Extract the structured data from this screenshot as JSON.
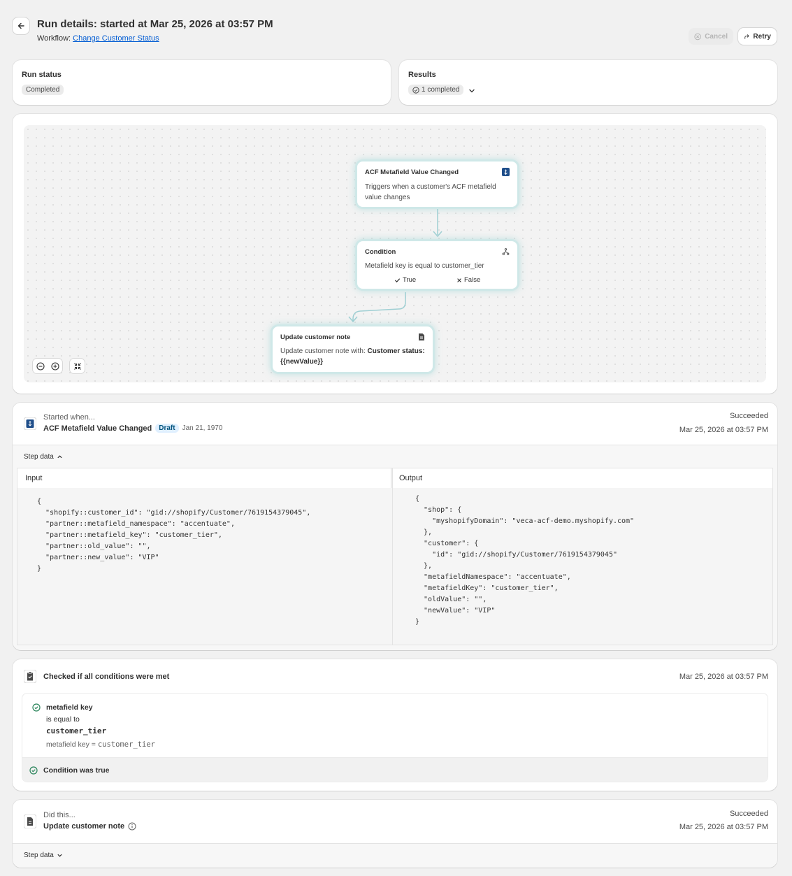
{
  "header": {
    "title": "Run details: started at Mar 25, 2026 at 03:57 PM",
    "workflow_prefix": "Workflow:",
    "workflow_link": "Change Customer Status",
    "cancel_label": "Cancel",
    "retry_label": "Retry"
  },
  "run_status": {
    "label": "Run status",
    "badge": "Completed"
  },
  "results": {
    "label": "Results",
    "badge": "1 completed"
  },
  "flow": {
    "trigger": {
      "title": "ACF Metafield Value Changed",
      "text": "Triggers when a customer's ACF metafield value changes"
    },
    "condition": {
      "title": "Condition",
      "text": "Metafield key is equal to customer_tier",
      "true_label": "True",
      "false_label": "False"
    },
    "action": {
      "title": "Update customer note",
      "text_prefix": "Update customer note with: ",
      "text_bold": "Customer status: {{newValue}}"
    }
  },
  "step1": {
    "caption": "Started when...",
    "name": "ACF Metafield Value Changed",
    "badge": "Draft",
    "date": "Jan 21, 1970",
    "status": "Succeeded",
    "timestamp": "Mar 25, 2026 at 03:57 PM",
    "step_data_label": "Step data",
    "input_label": "Input",
    "output_label": "Output",
    "input_code": "{\n  \"shopify::customer_id\": \"gid://shopify/Customer/7619154379045\",\n  \"partner::metafield_namespace\": \"accentuate\",\n  \"partner::metafield_key\": \"customer_tier\",\n  \"partner::old_value\": \"\",\n  \"partner::new_value\": \"VIP\"\n}",
    "output_code": "{\n  \"shop\": {\n    \"myshopifyDomain\": \"veca-acf-demo.myshopify.com\"\n  },\n  \"customer\": {\n    \"id\": \"gid://shopify/Customer/7619154379045\"\n  },\n  \"metafieldNamespace\": \"accentuate\",\n  \"metafieldKey\": \"customer_tier\",\n  \"oldValue\": \"\",\n  \"newValue\": \"VIP\"\n}"
  },
  "step2": {
    "title": "Checked if all conditions were met",
    "timestamp": "Mar 25, 2026 at 03:57 PM",
    "field": "metafield key",
    "operator": "is equal to",
    "value": "customer_tier",
    "evaluation_prefix": "metafield key = ",
    "evaluation_value": "customer_tier",
    "result": "Condition was true"
  },
  "step3": {
    "caption": "Did this...",
    "name": "Update customer note",
    "status": "Succeeded",
    "timestamp": "Mar 25, 2026 at 03:57 PM",
    "step_data_label": "Step data"
  }
}
